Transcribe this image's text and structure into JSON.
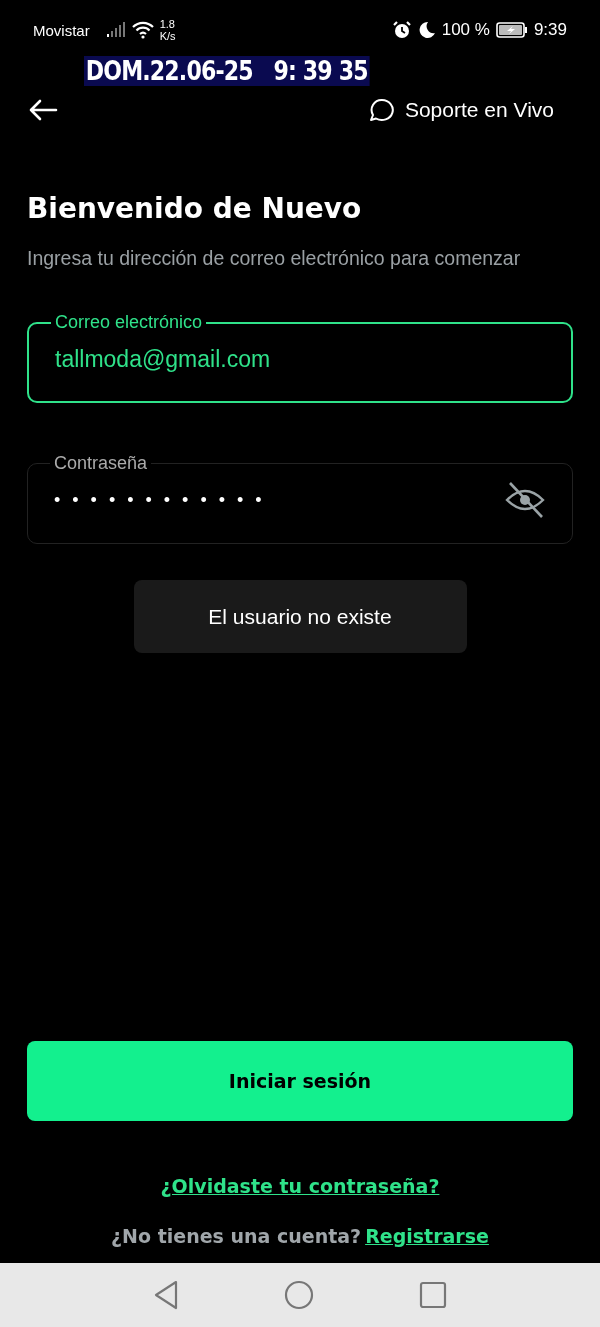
{
  "status_bar": {
    "carrier": "Movistar",
    "speed": "1.8",
    "speed_unit": "K/s",
    "battery": "100 %",
    "time": "9:39"
  },
  "date_overlay": "DOM.22.06-25   9: 39 35",
  "header": {
    "support": "Soporte en Vivo"
  },
  "title": "Bienvenido de Nuevo",
  "subtitle": "Ingresa tu dirección de correo electrónico para comenzar",
  "fields": [
    {
      "kind": "email",
      "label": "Correo electrónico",
      "value": "tallmoda@gmail.com",
      "focused": true
    },
    {
      "kind": "password",
      "label": "Contraseña",
      "value": "••••••••••••",
      "focused": false
    }
  ],
  "toast": "El usuario no existe",
  "login_button": "Iniciar sesión",
  "forgot_link": "¿Olvidaste tu contraseña?",
  "register": {
    "prompt": "¿No tienes una cuenta?",
    "link": "Registrarse"
  }
}
